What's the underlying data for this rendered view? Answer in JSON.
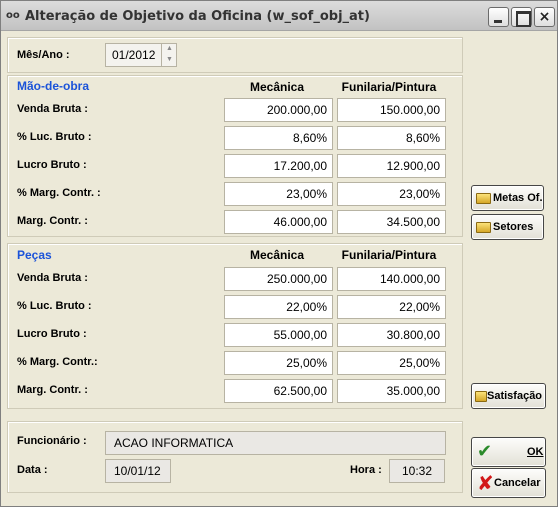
{
  "window": {
    "title": "Alteração de Objetivo da Oficina (w_sof_obj_at)",
    "app_icon": "glasses-icon",
    "controls": {
      "minimize": "minimize-icon",
      "maximize": "maximize-icon",
      "close": "×"
    }
  },
  "period": {
    "label": "Mês/Ano :",
    "value": "01/2012"
  },
  "mao_de_obra": {
    "title": "Mão-de-obra",
    "col_mecanica": "Mecânica",
    "col_funilaria": "Funilaria/Pintura",
    "rows": [
      {
        "label": "Venda Bruta :",
        "mecanica": "200.000,00",
        "funilaria": "150.000,00"
      },
      {
        "label": "% Luc. Bruto :",
        "mecanica": "8,60%",
        "funilaria": "8,60%"
      },
      {
        "label": "Lucro Bruto :",
        "mecanica": "17.200,00",
        "funilaria": "12.900,00"
      },
      {
        "label": "% Marg. Contr. :",
        "mecanica": "23,00%",
        "funilaria": "23,00%"
      },
      {
        "label": "Marg. Contr. :",
        "mecanica": "46.000,00",
        "funilaria": "34.500,00"
      }
    ]
  },
  "pecas": {
    "title": "Peças",
    "col_mecanica": "Mecânica",
    "col_funilaria": "Funilaria/Pintura",
    "rows": [
      {
        "label": "Venda Bruta :",
        "mecanica": "250.000,00",
        "funilaria": "140.000,00"
      },
      {
        "label": "% Luc. Bruto :",
        "mecanica": "22,00%",
        "funilaria": "22,00%"
      },
      {
        "label": "Lucro Bruto :",
        "mecanica": "55.000,00",
        "funilaria": "30.800,00"
      },
      {
        "label": "% Marg. Contr.:",
        "mecanica": "25,00%",
        "funilaria": "25,00%"
      },
      {
        "label": "Marg. Contr. :",
        "mecanica": "62.500,00",
        "funilaria": "35.000,00"
      }
    ]
  },
  "footer": {
    "funcionario_label": "Funcionário :",
    "funcionario_value": "ACAO INFORMATICA",
    "data_label": "Data :",
    "data_value": "10/01/12",
    "hora_label": "Hora :",
    "hora_value": "10:32"
  },
  "buttons": {
    "metas": "Metas Of.",
    "setores": "Setores",
    "satisfacao": "Satisfação",
    "ok": "OK",
    "cancelar": "Cancelar"
  },
  "colors": {
    "section_title": "#1b53d9",
    "window_bg": "#ece9d8"
  }
}
